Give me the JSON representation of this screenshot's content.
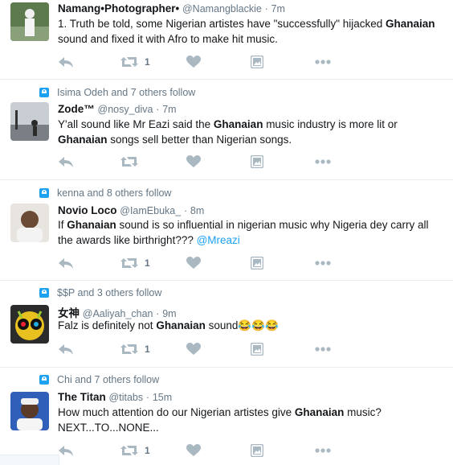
{
  "tweets": [
    {
      "context": "",
      "name": "Namang•Photographer•",
      "handle": "@Namangblackie",
      "dot": "·",
      "time": "7m",
      "line1_a": "1. Truth be told, some Nigerian artistes have \"successfully\" hijacked ",
      "line1_b": "Ghanaian",
      "line2": "sound and fixed it with Afro to make hit music.",
      "rt_count": "1"
    },
    {
      "context": "Isima Odeh and 7 others follow",
      "name": "Zode™",
      "handle": "@nosy_diva",
      "dot": "·",
      "time": "7m",
      "line1_a": "Y'all sound like Mr Eazi said the ",
      "line1_b": "Ghanaian",
      "line1_c": " music industry is more lit or",
      "line2_a": "Ghanaian",
      "line2_b": " songs sell better than Nigerian songs.",
      "rt_count": ""
    },
    {
      "context": "kenna and 8 others follow",
      "name": "Novio Loco",
      "handle": "@IamEbuka_",
      "dot": "·",
      "time": "8m",
      "line1_a": "If ",
      "line1_b": "Ghanaian",
      "line1_c": " sound is so influential in nigerian music why Nigeria dey carry all",
      "line2_a": "the awards like birthright??? ",
      "line2_mention": "@Mreazi",
      "rt_count": "1"
    },
    {
      "context": "$$P and 3 others follow",
      "name": "女神",
      "handle": "@Aaliyah_chan",
      "dot": "·",
      "time": "9m",
      "line1_a": "Falz is definitely not ",
      "line1_b": "Ghanaian",
      "line1_c": " sound",
      "emoji": "😂😂😂",
      "rt_count": "1"
    },
    {
      "context": "Chi and 7 others follow",
      "name": "The Titan",
      "handle": "@titabs",
      "dot": "·",
      "time": "15m",
      "line1_a": "How much attention do our Nigerian artistes give ",
      "line1_b": "Ghanaian",
      "line1_c": " music?",
      "line2": "NEXT...TO...NONE...",
      "rt_count": "1"
    }
  ],
  "icons": {
    "reply": "reply-icon",
    "retweet": "retweet-icon",
    "like": "heart-icon",
    "media": "media-icon",
    "more": "more-icon",
    "follow": "follow-icon"
  },
  "colors": {
    "accent": "#1da1f2",
    "muted": "#657786",
    "icon": "#aab8c2",
    "border": "#e6ecf0"
  }
}
